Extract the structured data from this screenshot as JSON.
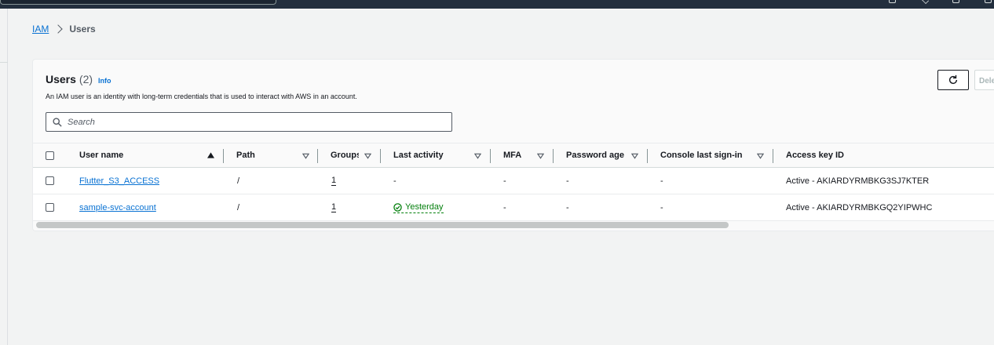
{
  "breadcrumb": {
    "root": "IAM",
    "current": "Users"
  },
  "panel": {
    "title": "Users",
    "count": "(2)",
    "info": "Info",
    "description": "An IAM user is an identity with long-term credentials that is used to interact with AWS in an account.",
    "delete_label": "Delete"
  },
  "search": {
    "placeholder": "Search"
  },
  "table": {
    "columns": [
      "User name",
      "Path",
      "Groups",
      "Last activity",
      "MFA",
      "Password age",
      "Console last sign-in",
      "Access key ID"
    ],
    "rows": [
      {
        "user": "Flutter_S3_ACCESS",
        "path": "/",
        "groups": "1",
        "activity": "-",
        "mfa": "-",
        "pwd": "-",
        "console": "-",
        "key": "Active - AKIARDYRMBKG3SJ7KTER"
      },
      {
        "user": "sample-svc-account",
        "path": "/",
        "groups": "1",
        "activity": "Yesterday",
        "mfa": "-",
        "pwd": "-",
        "console": "-",
        "key": "Active - AKIARDYRMBKGQ2YIPWHC"
      }
    ]
  },
  "icons": {
    "refresh": "refresh-icon",
    "search": "search-icon",
    "success": "status-positive-icon",
    "sort": "sort-icon"
  },
  "colors": {
    "link": "#0972d3",
    "success": "#037f0c",
    "topbar": "#232f3e"
  }
}
